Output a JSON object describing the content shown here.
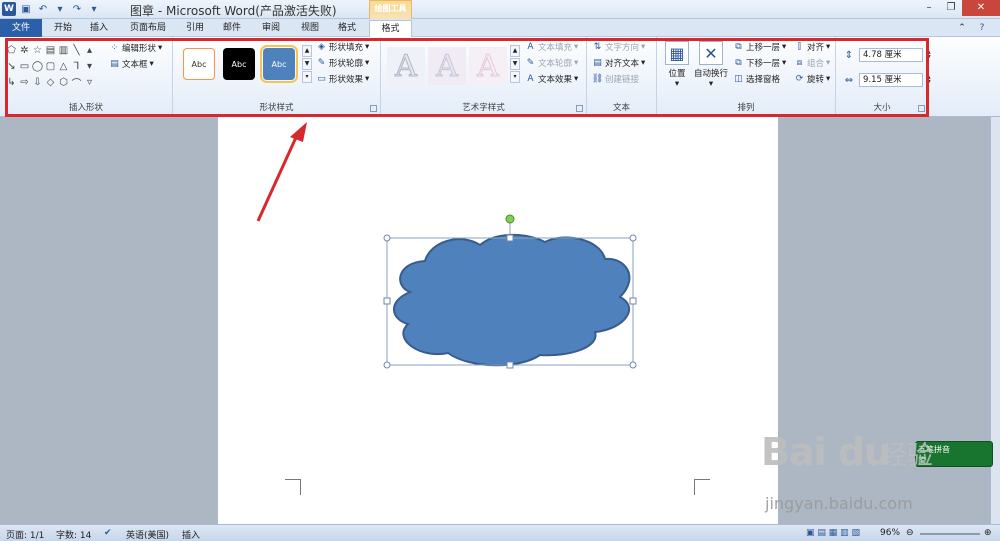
{
  "titlebar": {
    "title": "图章 - Microsoft Word(产品激活失败)",
    "context_label": "绘图工具",
    "minimize": "–",
    "restore": "❐",
    "close": "✕"
  },
  "tabs": [
    "文件",
    "开始",
    "插入",
    "页面布局",
    "引用",
    "邮件",
    "审阅",
    "视图",
    "格式",
    "格式"
  ],
  "ribbon": {
    "insert_shapes": {
      "edit_shape": "编辑形状",
      "text_box": "文本框",
      "label": "插入形状"
    },
    "shape_styles": {
      "styles": [
        "Abc",
        "Abc",
        "Abc"
      ],
      "fill": "形状填充",
      "outline": "形状轮廓",
      "effects": "形状效果",
      "label": "形状样式"
    },
    "wordart_styles": {
      "letters": [
        "A",
        "A",
        "A"
      ],
      "text_fill": "文本填充",
      "text_outline": "文本轮廓",
      "text_effects": "文本效果",
      "label": "艺术字样式"
    },
    "text": {
      "direction": "文字方向",
      "align_text": "对齐文本",
      "create_link": "创建链接",
      "label": "文本"
    },
    "arrange": {
      "position": "位置",
      "wrap": "自动换行",
      "bring_forward": "上移一层",
      "send_backward": "下移一层",
      "selection_pane": "选择窗格",
      "align": "对齐",
      "group": "组合",
      "rotate": "旋转",
      "label": "排列"
    },
    "size": {
      "height": "4.78 厘米",
      "width": "9.15 厘米",
      "label": "大小"
    }
  },
  "statusbar": {
    "page": "页面: 1/1",
    "words": "字数: 14",
    "language": "英语(美国)",
    "mode": "插入",
    "zoom": "96%"
  },
  "ime": {
    "name": "五笔拼音",
    "row2": "简"
  },
  "watermark": {
    "logo": "Bai du",
    "jingyan": "经验",
    "url": "jingyan.baidu.com"
  },
  "colors": {
    "cloud_fill": "#4f81bd",
    "cloud_stroke": "#385d8a",
    "highlight": "#d9272e",
    "file_tab": "#2b5fa8"
  }
}
